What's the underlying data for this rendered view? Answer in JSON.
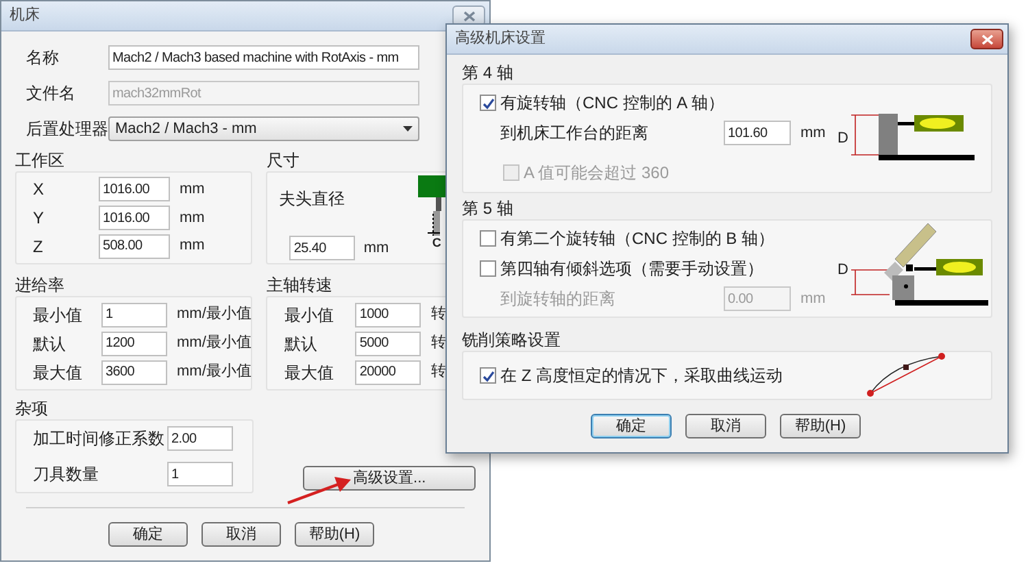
{
  "main_window": {
    "title": "机床",
    "fields": [
      {
        "kind": "text",
        "label": "名称",
        "value": "Mach2 / Mach3 based machine with RotAxis - mm",
        "disabled": false
      },
      {
        "kind": "text",
        "label": "文件名",
        "value": "mach32mmRot",
        "disabled": true
      },
      {
        "kind": "select",
        "label": "后置处理器",
        "value": "Mach2 / Mach3 - mm"
      }
    ],
    "work_area": {
      "title": "工作区",
      "rows": [
        {
          "label": "X",
          "value": "1016.00",
          "unit": "mm"
        },
        {
          "label": "Y",
          "value": "1016.00",
          "unit": "mm"
        },
        {
          "label": "Z",
          "value": "508.00",
          "unit": "mm"
        }
      ]
    },
    "size": {
      "title": "尺寸",
      "label": "夫头直径",
      "value": "25.40",
      "unit": "mm",
      "diagram_label": "C"
    },
    "feed_rate": {
      "title": "进给率",
      "rows": [
        {
          "label": "最小值",
          "value": "1",
          "unit": "mm/最小值"
        },
        {
          "label": "默认",
          "value": "1200",
          "unit": "mm/最小值"
        },
        {
          "label": "最大值",
          "value": "3600",
          "unit": "mm/最小值"
        }
      ]
    },
    "spindle_speed": {
      "title": "主轴转速",
      "rows": [
        {
          "label": "最小值",
          "value": "1000",
          "unit": "转"
        },
        {
          "label": "默认",
          "value": "5000",
          "unit": "转"
        },
        {
          "label": "最大值",
          "value": "20000",
          "unit": "转"
        }
      ]
    },
    "misc": {
      "title": "杂项",
      "rows": [
        {
          "label": "加工时间修正系数",
          "value": "2.00"
        },
        {
          "label": "刀具数量",
          "value": "1"
        }
      ]
    },
    "advanced_button": "高级设置...",
    "buttons": [
      {
        "label": "确定",
        "default": false
      },
      {
        "label": "取消",
        "default": false
      },
      {
        "label": "帮助(H)",
        "default": false
      }
    ]
  },
  "advanced_dialog": {
    "title": "高级机床设置",
    "groups": [
      {
        "title": "第 4 轴",
        "kind": "fourth_axis",
        "diagram_label": "D",
        "items": [
          {
            "kind": "checkbox",
            "label": "有旋转轴（CNC 控制的 A 轴）",
            "checked": true,
            "disabled": false
          },
          {
            "kind": "distance",
            "label": "到机床工作台的距离",
            "value": "101.60",
            "unit": "mm",
            "disabled": false
          },
          {
            "kind": "sub_checkbox",
            "label": "A 值可能会超过 360",
            "checked": false,
            "disabled": true
          }
        ]
      },
      {
        "title": "第 5 轴",
        "kind": "fifth_axis",
        "diagram_label": "D",
        "items": [
          {
            "kind": "checkbox",
            "label": "有第二个旋转轴（CNC 控制的 B 轴）",
            "checked": false,
            "disabled": false
          },
          {
            "kind": "checkbox",
            "label": "第四轴有倾斜选项（需要手动设置）",
            "checked": false,
            "disabled": false
          },
          {
            "kind": "distance",
            "label": "到旋转轴的距离",
            "value": "0.00",
            "unit": "mm",
            "disabled": true
          }
        ]
      },
      {
        "title": "铣削策略设置",
        "kind": "arc",
        "items": [
          {
            "kind": "checkbox",
            "label": "在 Z 高度恒定的情况下，采取曲线运动",
            "checked": true,
            "disabled": false
          }
        ]
      }
    ],
    "buttons": [
      {
        "label": "确定",
        "default": true
      },
      {
        "label": "取消",
        "default": false
      },
      {
        "label": "帮助(H)",
        "default": false
      }
    ]
  }
}
